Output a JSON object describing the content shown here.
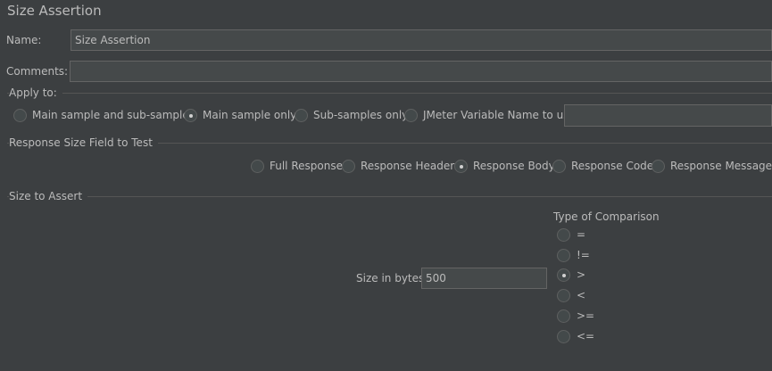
{
  "panel": {
    "title": "Size Assertion"
  },
  "name_field": {
    "label": "Name:",
    "value": "Size Assertion"
  },
  "comments_field": {
    "label": "Comments:",
    "value": ""
  },
  "apply_to": {
    "title": "Apply to:",
    "options": [
      {
        "label": "Main sample and sub-samples",
        "checked": false
      },
      {
        "label": "Main sample only",
        "checked": true
      },
      {
        "label": "Sub-samples only",
        "checked": false
      },
      {
        "label": "JMeter Variable Name to use",
        "checked": false
      }
    ],
    "variable_value": ""
  },
  "response_field": {
    "title": "Response Size Field to Test",
    "options": [
      {
        "label": "Full Response",
        "checked": false
      },
      {
        "label": "Response Headers",
        "checked": false
      },
      {
        "label": "Response Body",
        "checked": true
      },
      {
        "label": "Response Code",
        "checked": false
      },
      {
        "label": "Response Message",
        "checked": false
      }
    ]
  },
  "size_to_assert": {
    "title": "Size to Assert",
    "size_label": "Size in bytes:",
    "size_value": "500",
    "comparison": {
      "title": "Type of Comparison",
      "options": [
        {
          "label": "=",
          "checked": false
        },
        {
          "label": "!=",
          "checked": false
        },
        {
          "label": ">",
          "checked": true
        },
        {
          "label": "<",
          "checked": false
        },
        {
          "label": ">=",
          "checked": false
        },
        {
          "label": "<=",
          "checked": false
        }
      ]
    }
  }
}
